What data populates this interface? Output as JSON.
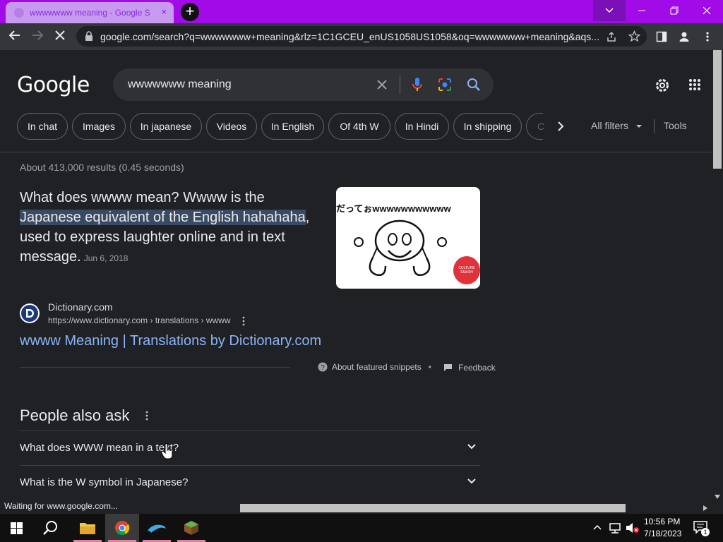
{
  "browser": {
    "tab_title": "wwwwwww meaning - Google S",
    "tab_close": "×",
    "new_tab": "+",
    "url": "google.com/search?q=wwwwwww+meaning&rlz=1C1GCEU_enUS1058US1058&oq=wwwwwww+meaning&aqs..."
  },
  "header": {
    "logo": "Google",
    "query": "wwwwwww meaning",
    "chips": [
      "In chat",
      "Images",
      "In japanese",
      "Videos",
      "In English",
      "Of 4th W",
      "In Hindi",
      "In shipping",
      "C"
    ],
    "all_filters": "All filters",
    "tools": "Tools"
  },
  "results": {
    "stats": "About 413,000 results (0.45 seconds)",
    "snippet_pre": "What does wwww mean? Wwww is the ",
    "snippet_highlight": "Japanese equivalent of the English hahahaha",
    "snippet_post": ", used to express laughter online and in text message.",
    "snippet_date": "Jun 6, 2018",
    "thumb_caption": "だってぉwwwwwwwwwww",
    "thumb_badge": "CULTURE SMASH",
    "site_name": "Dictionary.com",
    "site_cite": "https://www.dictionary.com › translations › wwww",
    "link_title": "wwww Meaning | Translations by Dictionary.com",
    "about_snippets": "About featured snippets",
    "separator": "•",
    "feedback": "Feedback"
  },
  "people_also_ask": {
    "title": "People also ask",
    "questions": [
      "What does WWW mean in a text?",
      "What is the W symbol in Japanese?"
    ]
  },
  "status_bar": "Waiting for www.google.com...",
  "taskbar": {
    "time": "10:56 PM",
    "date": "7/18/2023",
    "notification_count": "1"
  },
  "colors": {
    "titlebar": "#a10be8",
    "link": "#8ab4f8",
    "highlight": "#3b4a63",
    "background": "#202124"
  }
}
